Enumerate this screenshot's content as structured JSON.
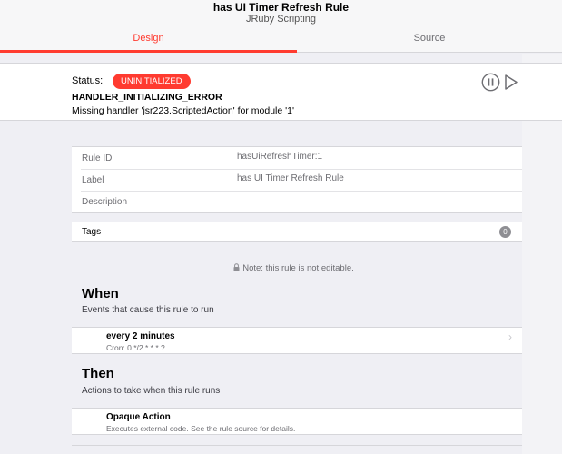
{
  "header": {
    "title": "has UI Timer Refresh Rule",
    "subtitle": "JRuby Scripting",
    "tabs": [
      {
        "label": "Design",
        "active": true
      },
      {
        "label": "Source",
        "active": false
      }
    ],
    "accent_color": "#ff3b30"
  },
  "status": {
    "label": "Status:",
    "badge": "UNINITIALIZED",
    "badge_color": "#ff3b30",
    "error_code": "HANDLER_INITIALIZING_ERROR",
    "error_message": "Missing handler 'jsr223.ScriptedAction' for module '1'",
    "controls": {
      "pause_icon": "pause-circle-icon",
      "play_icon": "play-icon"
    }
  },
  "info": {
    "rows": [
      {
        "key": "Rule ID",
        "value": "hasUiRefreshTimer:1"
      },
      {
        "key": "Label",
        "value": "has UI Timer Refresh Rule"
      },
      {
        "key": "Description",
        "value": ""
      }
    ]
  },
  "tags": {
    "label": "Tags",
    "count": "0"
  },
  "note": "Note: this rule is not editable.",
  "when": {
    "title": "When",
    "subtitle": "Events that cause this rule to run",
    "item": {
      "title": "every 2 minutes",
      "subtitle": "Cron: 0 */2 * * * ?"
    }
  },
  "then": {
    "title": "Then",
    "subtitle": "Actions to take when this rule runs",
    "item": {
      "title": "Opaque Action",
      "subtitle": "Executes external code. See the rule source for details."
    }
  }
}
